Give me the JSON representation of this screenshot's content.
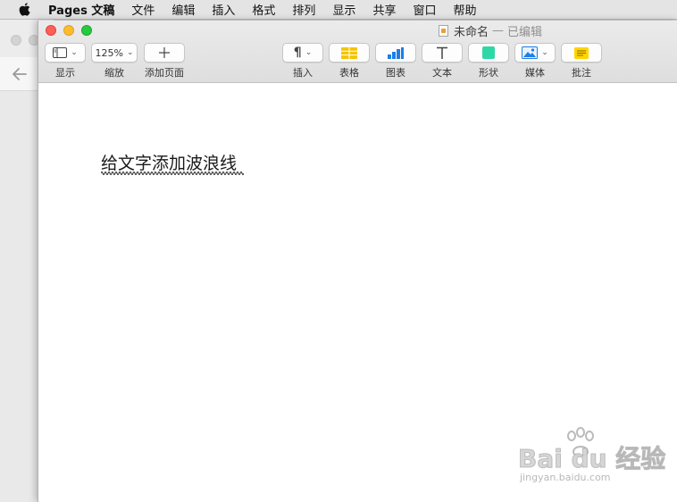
{
  "menubar": {
    "app_name": "Pages 文稿",
    "items": [
      "文件",
      "编辑",
      "插入",
      "格式",
      "排列",
      "显示",
      "共享",
      "窗口",
      "帮助"
    ]
  },
  "window": {
    "title": "未命名",
    "separator": "—",
    "status": "已编辑"
  },
  "toolbar": {
    "view_label": "显示",
    "zoom_value": "125%",
    "zoom_label": "缩放",
    "add_page_label": "添加页面",
    "insert_label": "插入",
    "table_label": "表格",
    "chart_label": "图表",
    "text_label": "文本",
    "shape_label": "形状",
    "media_label": "媒体",
    "comment_label": "批注"
  },
  "document": {
    "body_text": "给文字添加波浪线"
  },
  "watermark": {
    "brand": "Bai  du 经验",
    "url": "jingyan.baidu.com"
  },
  "colors": {
    "close": "#fe5f57",
    "minimize": "#febc2e",
    "zoom": "#28c840",
    "table_icon": "#f5c400",
    "chart_icon": "#1e7ee6",
    "shape_icon": "#2ed8a6",
    "comment_icon": "#ffd400"
  }
}
